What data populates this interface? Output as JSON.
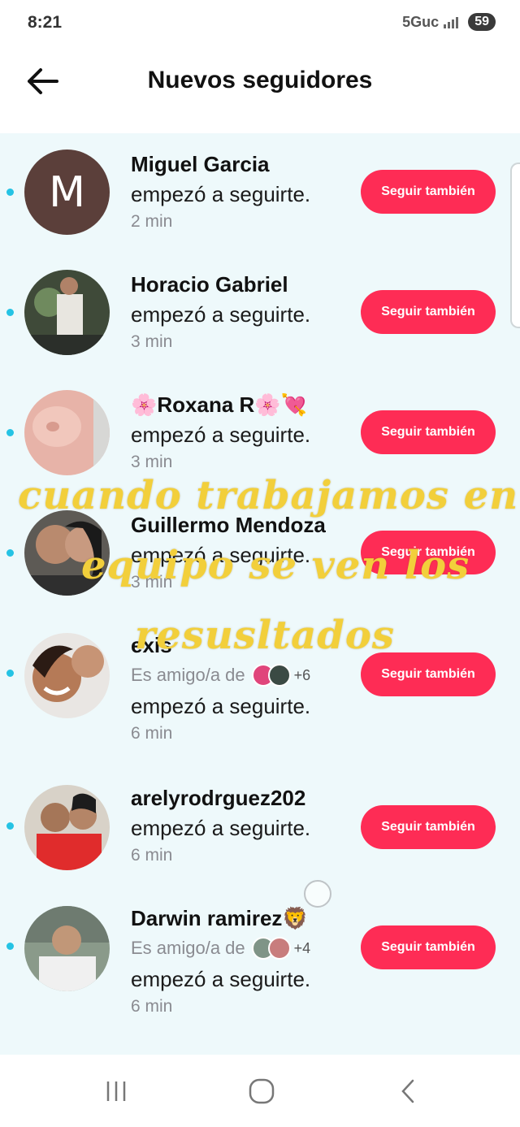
{
  "status_bar": {
    "time": "8:21",
    "network": "5Guc",
    "battery": "59"
  },
  "header": {
    "title": "Nuevos seguidores"
  },
  "followers": [
    {
      "name": "Miguel Garcia",
      "action": "empezó a seguirte.",
      "time": "2 min",
      "button": "Seguir también",
      "avatar_letter": "M"
    },
    {
      "name": "Horacio Gabriel",
      "action": "empezó a seguirte.",
      "time": "3 min",
      "button": "Seguir también"
    },
    {
      "name": "🌸Roxana R🌸💘",
      "action": "empezó a seguirte.",
      "time": "3 min",
      "button": "Seguir también"
    },
    {
      "name": "Guillermo Mendoza",
      "action": "empezó a seguirte.",
      "time": "3 min",
      "button": "Seguir también"
    },
    {
      "name": "exis",
      "mutual_text": "Es amigo/a de",
      "mutual_more": "+6",
      "action": "empezó a seguirte.",
      "time": "6 min",
      "button": "Seguir también"
    },
    {
      "name": "arelyrodrguez202",
      "action": "empezó a seguirte.",
      "time": "6 min",
      "button": "Seguir también"
    },
    {
      "name": "Darwin  ramirez🦁",
      "mutual_text": "Es amigo/a de",
      "mutual_more": "+4",
      "action": "empezó a seguirte.",
      "time": "6 min",
      "button": "Seguir también"
    }
  ],
  "overlay": {
    "line1": "cuando trabajamos en",
    "line2": "equipo se ven los",
    "line3": "resusltados"
  },
  "colors": {
    "accent": "#fe2c55",
    "unread_dot": "#25c3e4",
    "list_bg": "#eef9fb",
    "overlay_text": "#f2cf3b"
  }
}
